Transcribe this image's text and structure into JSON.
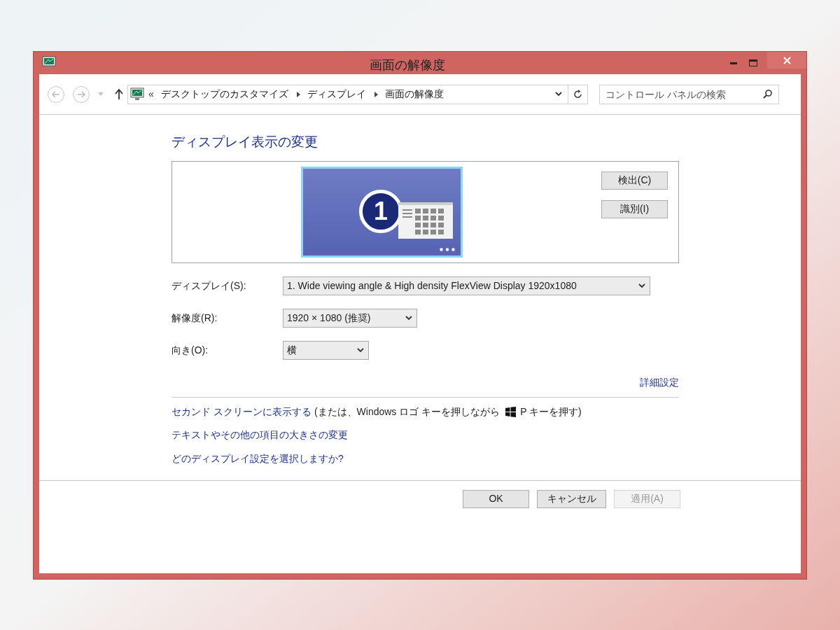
{
  "window": {
    "title": "画面の解像度"
  },
  "address_bar": {
    "overflow": "«",
    "breadcrumbs": [
      "デスクトップのカスタマイズ",
      "ディスプレイ",
      "画面の解像度"
    ]
  },
  "search": {
    "placeholder": "コントロール パネルの検索"
  },
  "heading": "ディスプレイ表示の変更",
  "preview": {
    "display_number": "1",
    "buttons": [
      "検出(C)",
      "識別(I)"
    ]
  },
  "settings": [
    {
      "label": "ディスプレイ(S):",
      "value": "1. Wide viewing angle & High density FlexView Display 1920x1080"
    },
    {
      "label": "解像度(R):",
      "value": "1920 × 1080 (推奨)"
    },
    {
      "label": "向き(O):",
      "value": "横"
    }
  ],
  "advanced_link": "詳細設定",
  "second_screen": {
    "link": "セカンド スクリーンに表示する",
    "text_before_icon": "(または、Windows ロゴ キーを押しながら",
    "text_after_icon": "P キーを押す)"
  },
  "links": [
    "テキストやその他の項目の大きさの変更",
    "どのディスプレイ設定を選択しますか?"
  ],
  "buttons": [
    {
      "label": "OK",
      "disabled": false
    },
    {
      "label": "キャンセル",
      "disabled": false
    },
    {
      "label": "適用(A)",
      "disabled": true
    }
  ]
}
